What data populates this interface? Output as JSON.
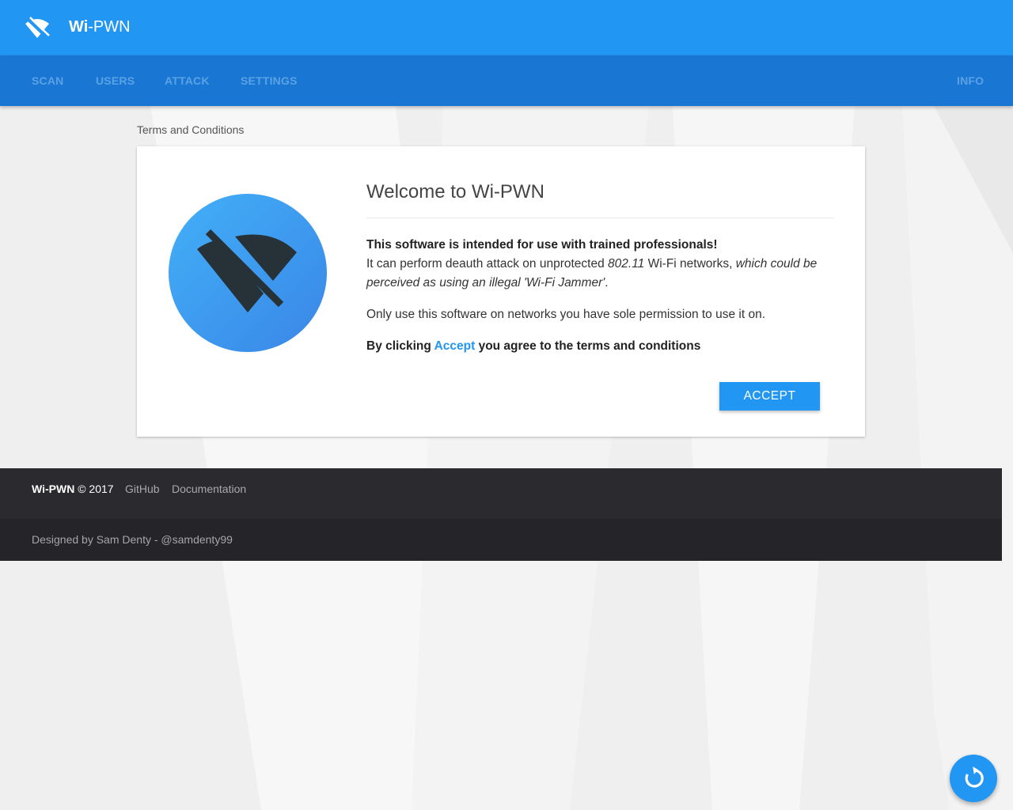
{
  "app": {
    "brand_bold": "Wi",
    "brand_rest": "-PWN"
  },
  "nav": {
    "items": [
      "SCAN",
      "USERS",
      "ATTACK",
      "SETTINGS"
    ],
    "info": "INFO"
  },
  "section": {
    "title": "Terms and Conditions"
  },
  "card": {
    "heading": "Welcome to Wi-PWN",
    "warning_bold": "This software is intended for use with trained professionals!",
    "line2_a": "It can perform deauth attack on unprotected ",
    "line2_b_italic": "802.11",
    "line2_c": " Wi-Fi networks, ",
    "line2_d_italic": "which could be perceived as using an illegal 'Wi-Fi Jammer'",
    "line2_e": ".",
    "permission": "Only use this software on networks you have sole permission to use it on.",
    "agree_a": "By clicking ",
    "agree_accent": "Accept",
    "agree_b": " you agree to the terms and conditions",
    "accept_button": "ACCEPT"
  },
  "footer": {
    "brand_bold": "Wi-PWN",
    "copyright": " © 2017",
    "links": [
      "GitHub",
      "Documentation"
    ],
    "credit": "Designed by Sam Denty - @samdenty99"
  },
  "icons": {
    "logo": "wifi-off-icon",
    "hero": "wifi-off-icon",
    "fab": "refresh-icon"
  },
  "colors": {
    "primary": "#2196f3",
    "nav": "#1976d2",
    "footer": "#2b2a2f"
  }
}
